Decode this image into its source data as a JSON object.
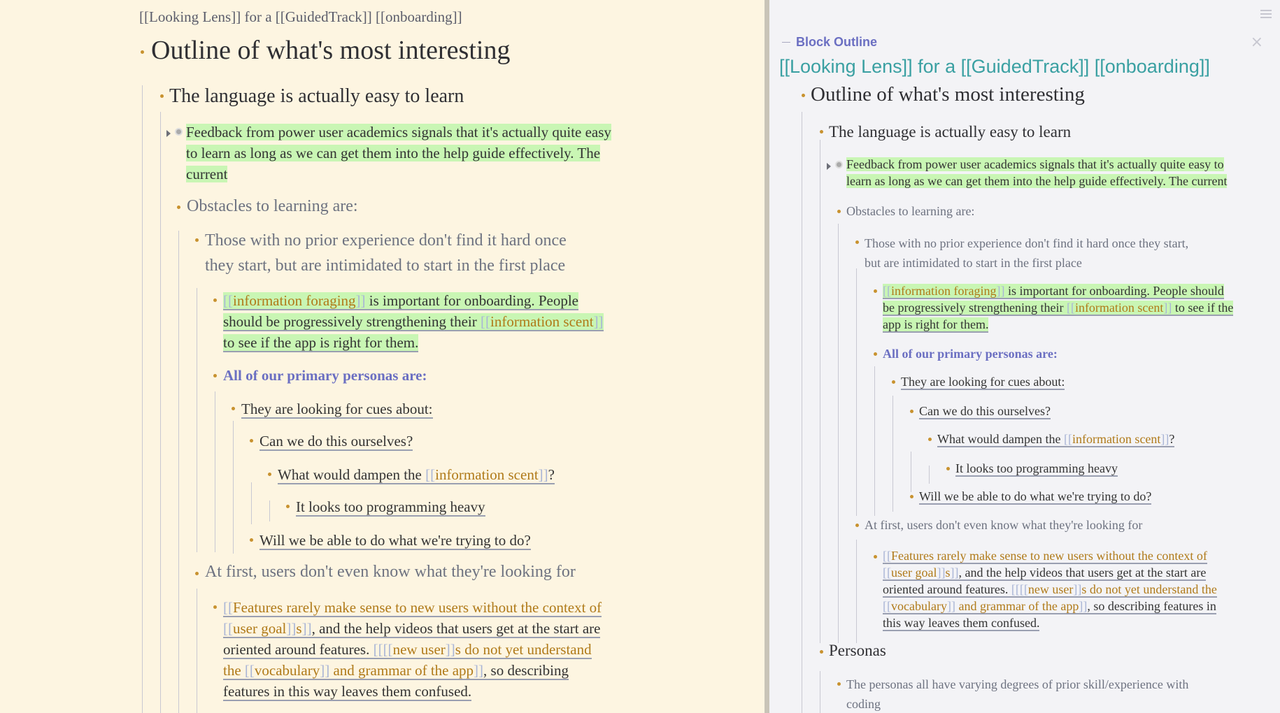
{
  "main": {
    "page_title": "[[Looking Lens]] for a [[GuidedTrack]] [[onboarding]]",
    "heading": "Outline of what's most interesting",
    "blocks": {
      "language": "The language is actually easy to learn",
      "feedback_l1": "Feedback from power user academics signals that it's actually quite easy",
      "feedback_l2": "to learn as long as we can get them into the help guide effectively. The",
      "feedback_l3": "current",
      "obstacles": "Obstacles to learning are:",
      "no_prior_l1": "Those with no prior experience don't find it hard once",
      "no_prior_l2": "they start, but are intimidated to start in the first place",
      "info_foraging_link": "information foraging",
      "info_foraging_rest": " is important for onboarding.  People",
      "info_l2_pre": "should be progressively strengthening their ",
      "info_scent_link": "information scent",
      "info_l3": "to see if the app is right for them.",
      "personas": "All of our primary personas are:",
      "looking_cues": "They are looking for cues about:",
      "can_we": "Can we do this ourselves?",
      "dampen_pre": "What would dampen the ",
      "dampen_link": "information scent",
      "dampen_post": "?",
      "too_programming": "It looks too programming heavy",
      "will_we": "Will we be able to do what we're trying to do?",
      "at_first": "At first, users don't even know what they're looking for",
      "features_l1": "Features rarely make sense to new users without the context of",
      "features_user_goal": "user goal",
      "features_s": "s",
      "features_l2_rest": ", and the help videos that users get at the start are",
      "features_l3_pre": "oriented around features.  ",
      "features_new_user": "new user",
      "features_l3_rest": "s do not yet understand",
      "features_l4_the": "the ",
      "features_vocab": "vocabulary",
      "features_grammar": " and grammar of the app",
      "features_l4_rest": ", so describing",
      "features_l5": "features in this way leaves them confused."
    }
  },
  "sidebar": {
    "header": "Block Outline",
    "close_glyph": "×",
    "page_title": "[[Looking Lens]] for a [[GuidedTrack]] [[onboarding]]",
    "heading": "Outline of what's most interesting",
    "blocks": {
      "language": "The language is actually easy to learn",
      "feedback_l1": "Feedback from power user academics signals that it's actually quite easy to",
      "feedback_l2": "learn as long as we can get them into the help guide effectively. The current",
      "obstacles": "Obstacles to learning are:",
      "no_prior_l1": "Those with no prior experience don't find it hard once they start,",
      "no_prior_l2": "but are intimidated to start in the first place",
      "info_foraging_link": "information foraging",
      "info_foraging_rest": " is important for onboarding.  People should",
      "info_l2_pre": "be progressively strengthening their ",
      "info_scent_link": "information scent",
      "info_l2_post": " to see if the",
      "info_l3": "app is right for them.",
      "personas": "All of our primary personas are:",
      "looking_cues": "They are looking for cues about:",
      "can_we": "Can we do this ourselves?",
      "dampen_pre": "What would dampen the ",
      "dampen_link": "information scent",
      "dampen_post": "?",
      "too_programming": "It looks too programming heavy",
      "will_we": "Will we be able to do what we're trying to do?",
      "at_first": "At first, users don't even know what they're looking for",
      "features_l1": "Features rarely make sense to new users without the context of",
      "features_user_goal": "user goal",
      "features_s": "s",
      "features_l2_rest": ", and the help videos that users get at the start are",
      "features_l3_pre": "oriented around features.  ",
      "features_new_user": "new user",
      "features_l3_rest": "s do not yet understand the",
      "features_vocab": "vocabulary",
      "features_grammar": " and grammar of the app",
      "features_l4_rest": ", so describing features in",
      "features_l5": "this way leaves them confused.",
      "personas_heading": "Personas",
      "personas_vary_l1": "The personas all have varying degrees of prior skill/experience with",
      "personas_vary_l2": "coding"
    }
  },
  "colors": {
    "main_bg": "#fdf5e1",
    "side_bg": "#f3f3f6",
    "bullet": "#c8922f",
    "highlight": "#c9f6b4",
    "link": "#b07a19",
    "purple": "#6b6fc2",
    "teal": "#3aa0a2"
  }
}
